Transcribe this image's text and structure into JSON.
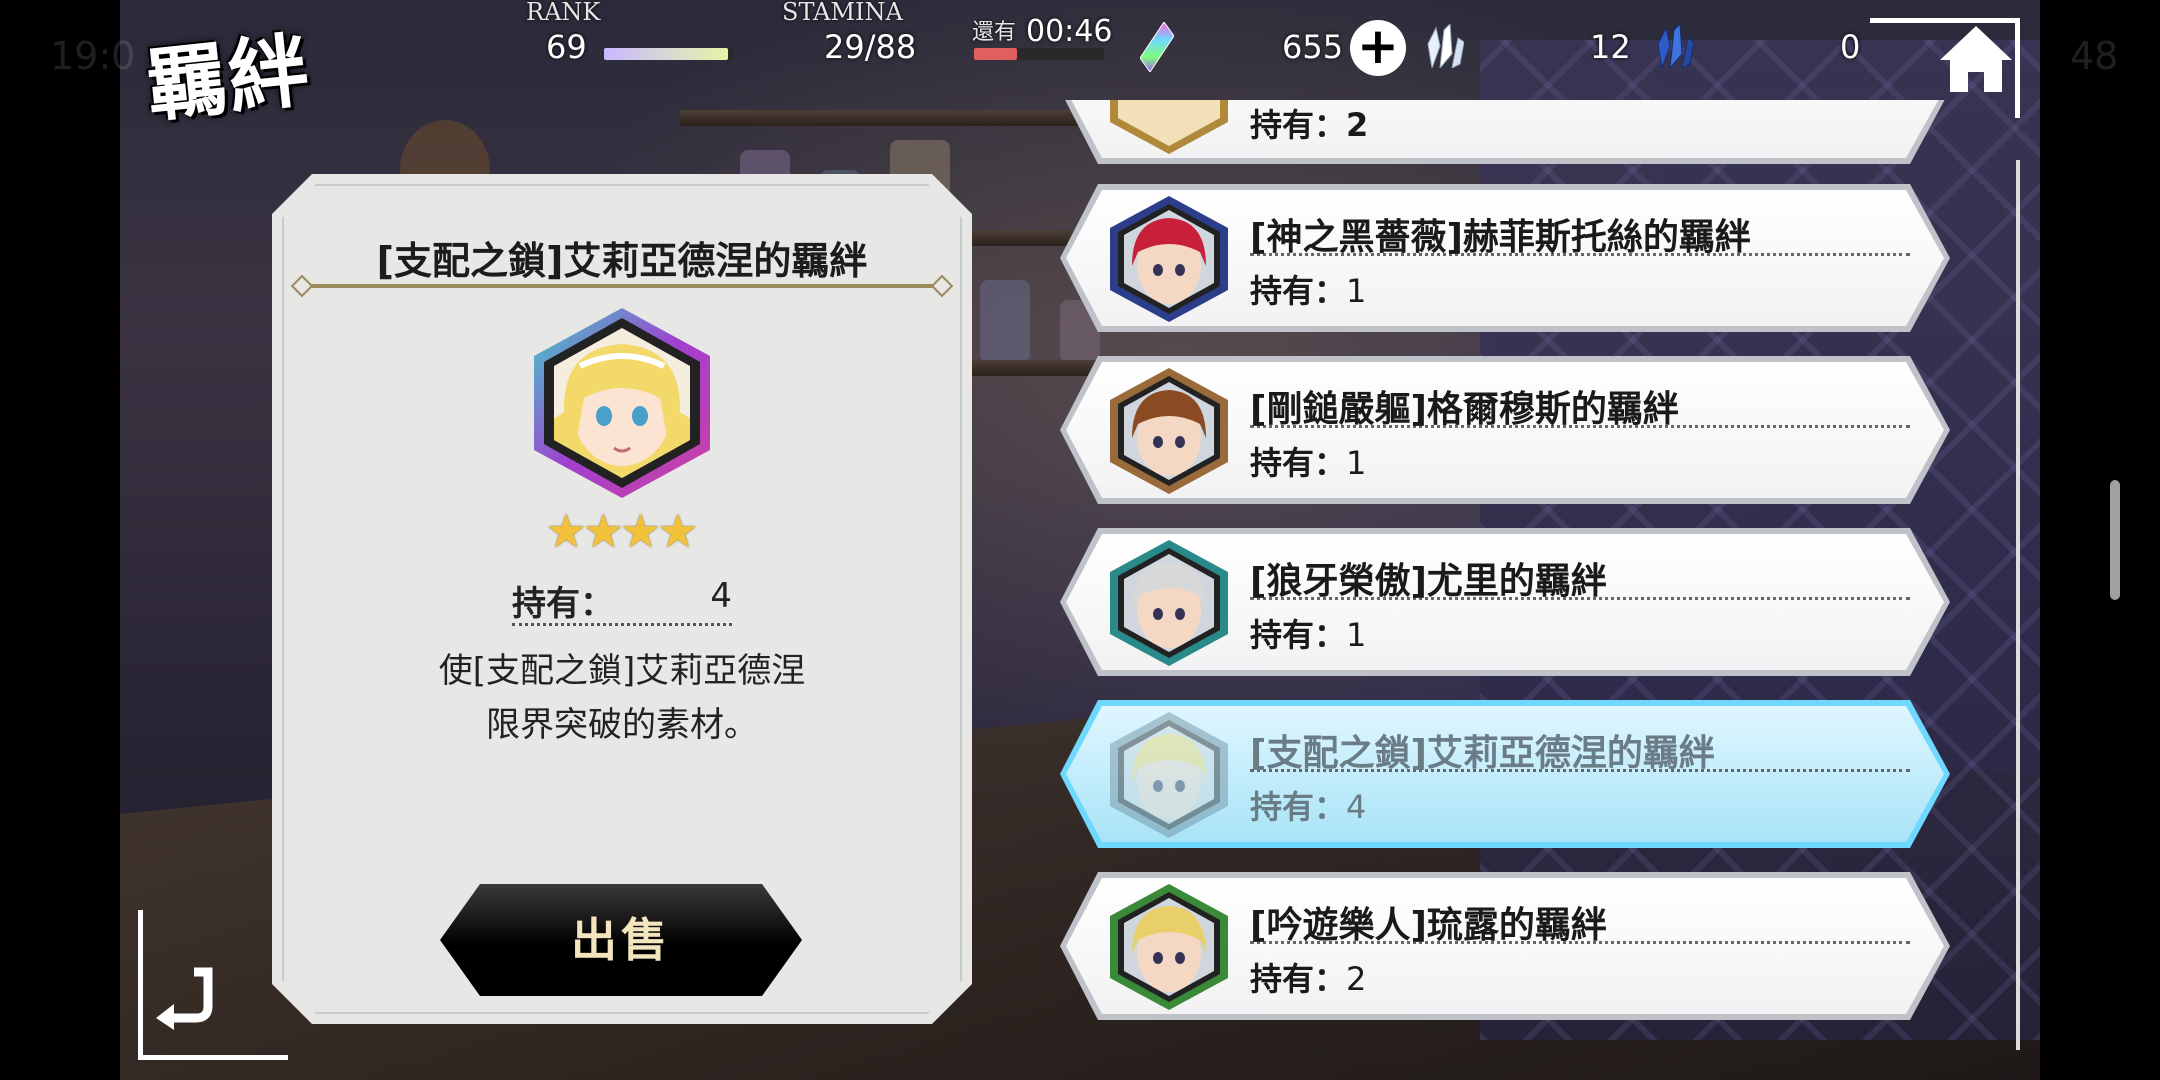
{
  "status_bar": {
    "time": "19:0",
    "battery": "48"
  },
  "header": {
    "title": "羈絆",
    "rank": {
      "label": "RANK",
      "value": "69",
      "progress": 0.95
    },
    "stamina": {
      "label": "STAMINA",
      "value": "29/88",
      "progress": 0.33
    },
    "recovery": {
      "label": "還有",
      "time": "00:46"
    },
    "currencies": [
      {
        "name": "rainbow-gem",
        "value": "655",
        "color": "#a05cff"
      },
      {
        "name": "white-crystal",
        "value": "12",
        "color": "#dfe9f5"
      },
      {
        "name": "blue-crystal",
        "value": "0",
        "color": "#2d5cc9"
      }
    ],
    "plus_glyph": "+"
  },
  "detail": {
    "title": "[支配之鎖]艾莉亞德涅的羈絆",
    "stars": 4,
    "owned_label": "持有：",
    "owned_value": "4",
    "description_line1": "使[支配之鎖]艾莉亞德涅",
    "description_line2": "限界突破的素材。",
    "sell_label": "出售"
  },
  "list": {
    "partial_top": {
      "owned_text": "持有：2"
    },
    "items": [
      {
        "name": "[神之黑薔薇]赫菲斯托絲的羈絆",
        "owned_label": "持有：",
        "owned": "1",
        "hair": "#c8203a",
        "frame": "#2c3e8a",
        "selected": false
      },
      {
        "name": "[剛鎚嚴軀]格爾穆斯的羈絆",
        "owned_label": "持有：",
        "owned": "1",
        "hair": "#8a4b22",
        "frame": "#9a6b3a",
        "selected": false
      },
      {
        "name": "[狼牙榮傲]尤里的羈絆",
        "owned_label": "持有：",
        "owned": "1",
        "hair": "#d8d8d8",
        "frame": "#2a8a8a",
        "selected": false
      },
      {
        "name": "[支配之鎖]艾莉亞德涅的羈絆",
        "owned_label": "持有：",
        "owned": "4",
        "hair": "#f3d86a",
        "frame": "#6a8a9a",
        "selected": true
      },
      {
        "name": "[吟遊樂人]琉露的羈絆",
        "owned_label": "持有：",
        "owned": "2",
        "hair": "#e8cf6a",
        "frame": "#3a8a3a",
        "selected": false
      }
    ]
  },
  "colors": {
    "accent_selected": "#6fd8ff",
    "star": "#f2c23a",
    "rank_bar": "#e6f5a8",
    "stamina_bar": "#e06060"
  }
}
